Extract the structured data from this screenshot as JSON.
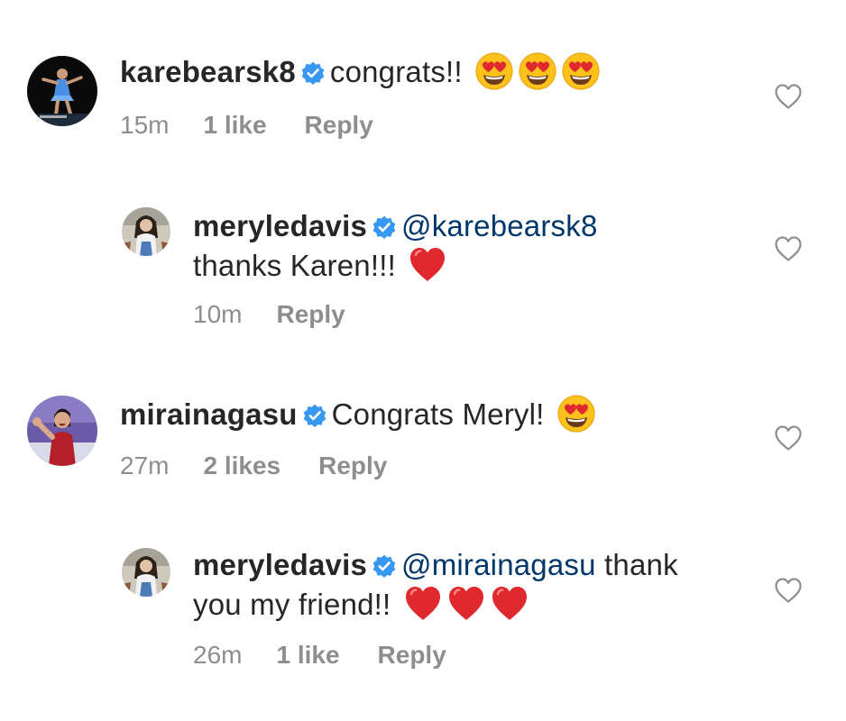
{
  "comments": [
    {
      "username": "karebearsk8",
      "text": "congrats!!",
      "emojis": [
        "heart-eyes-emoji",
        "heart-eyes-emoji",
        "heart-eyes-emoji"
      ],
      "time": "15m",
      "likes": "1 like",
      "reply_label": "Reply"
    },
    {
      "username": "meryledavis",
      "mention": "@karebearsk8",
      "text_line2": "thanks Karen!!!",
      "emojis": [
        "red-heart-emoji"
      ],
      "time": "10m",
      "reply_label": "Reply"
    },
    {
      "username": "mirainagasu",
      "text": "Congrats Meryl!",
      "emojis": [
        "heart-eyes-emoji"
      ],
      "time": "27m",
      "likes": "2 likes",
      "reply_label": "Reply"
    },
    {
      "username": "meryledavis",
      "mention": "@mirainagasu",
      "text_after_mention": "thank",
      "text_line2": "you my friend!!",
      "emojis": [
        "red-heart-emoji",
        "red-heart-emoji",
        "red-heart-emoji"
      ],
      "time": "26m",
      "likes": "1 like",
      "reply_label": "Reply"
    }
  ],
  "colors": {
    "verified_badge": "#3897f0",
    "mention": "#00376b",
    "meta_text": "#8e8e8e",
    "heart_emoji": "#e0292e",
    "emoji_face": "#fcc21b"
  },
  "icons": {
    "verified": "verified-badge-icon",
    "like": "like-heart-icon"
  }
}
